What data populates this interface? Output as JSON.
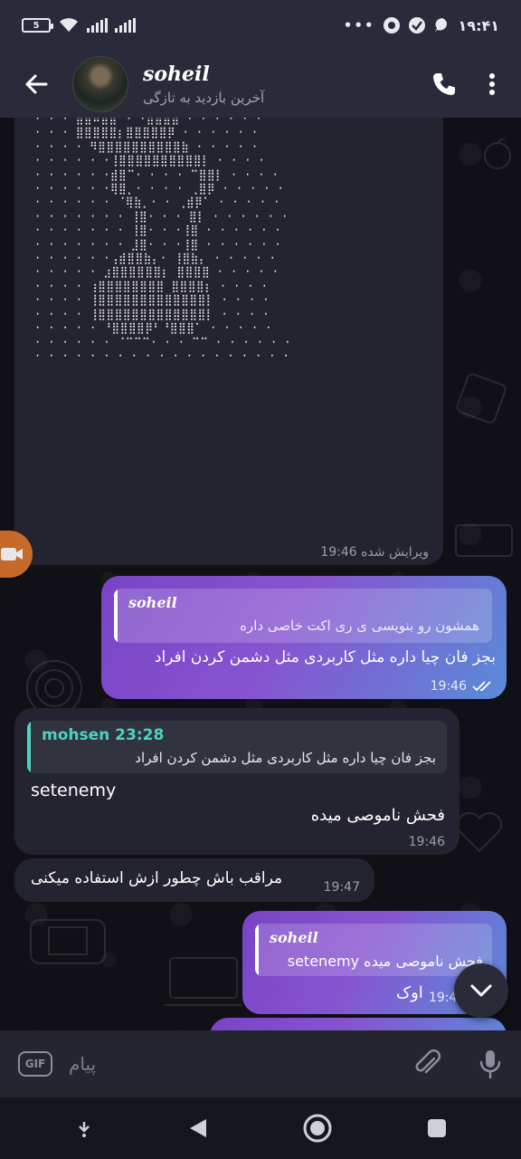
{
  "status_bar": {
    "battery": "5",
    "time": "۱۹:۴۱"
  },
  "header": {
    "contact_name": "soheil",
    "last_seen": "آخرین بازدید به تازگی"
  },
  "messages": {
    "ascii": {
      "meta": "ویرایش شده 19:46"
    },
    "out1": {
      "reply_name": "soheil",
      "reply_text": "همشون رو بنویسی ی ری اکت خاصی داره",
      "text": "بجز فان چیا داره مثل کاربردی مثل دشمن کردن افراد",
      "time": "19:46"
    },
    "in1": {
      "reply_name": "mohsen",
      "reply_time": "23:28",
      "reply_text": "بجز فان چیا داره مثل کاربردی مثل دشمن کردن افراد",
      "line1": "setenemy",
      "line2": "فحش ناموصی میده",
      "time": "19:46"
    },
    "in2": {
      "text": "مراقب باش چطور ازش استفاده میکنی",
      "time": "19:47"
    },
    "out2": {
      "reply_name": "soheil",
      "reply_text": "فحش ناموصی میده setenemy",
      "text": "اوک",
      "time": "19:4"
    }
  },
  "input": {
    "gif_label": "GIF",
    "placeholder": "پیام"
  }
}
